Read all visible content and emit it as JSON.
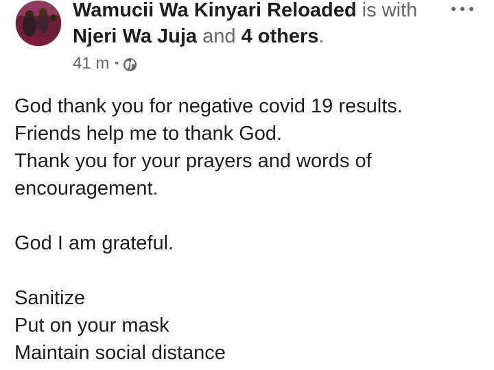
{
  "post": {
    "author": "Wamucii Wa Kinyari Reloaded",
    "with_text": "is with",
    "tagged_person": "Njeri Wa Juja",
    "and_text": "and",
    "others": "4 others",
    "period": ".",
    "time": "41 m",
    "separator": "•",
    "privacy_icon": "globe-icon",
    "more_icon": "more-dots-icon",
    "body_lines": [
      "God thank you for negative covid 19 results.",
      "Friends help me to thank God.",
      "Thank you for your prayers and words of",
      "encouragement.",
      "",
      "God I am grateful.",
      "",
      "Sanitize",
      "Put on your mask",
      "Maintain social distance"
    ]
  },
  "colors": {
    "text_primary": "#1c1e21",
    "text_secondary": "#65676b",
    "background": "#ffffff"
  }
}
